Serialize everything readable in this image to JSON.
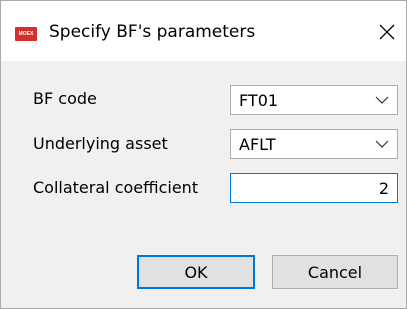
{
  "dialog": {
    "title": "Specify BF's parameters",
    "app_icon_text": "MOEX",
    "fields": {
      "bf_code": {
        "label": "BF code",
        "value": "FT01"
      },
      "underlying_asset": {
        "label": "Underlying asset",
        "value": "AFLT"
      },
      "collateral_coefficient": {
        "label": "Collateral coefficient",
        "value": "2"
      }
    },
    "buttons": {
      "ok": "OK",
      "cancel": "Cancel"
    }
  },
  "icons": {
    "close": "close-icon",
    "dropdown": "chevron-down-icon",
    "app": "app-logo-icon"
  },
  "colors": {
    "accent": "#0078d7",
    "app_icon": "#d32f2f",
    "dialog_bg": "#f0f0f0"
  }
}
